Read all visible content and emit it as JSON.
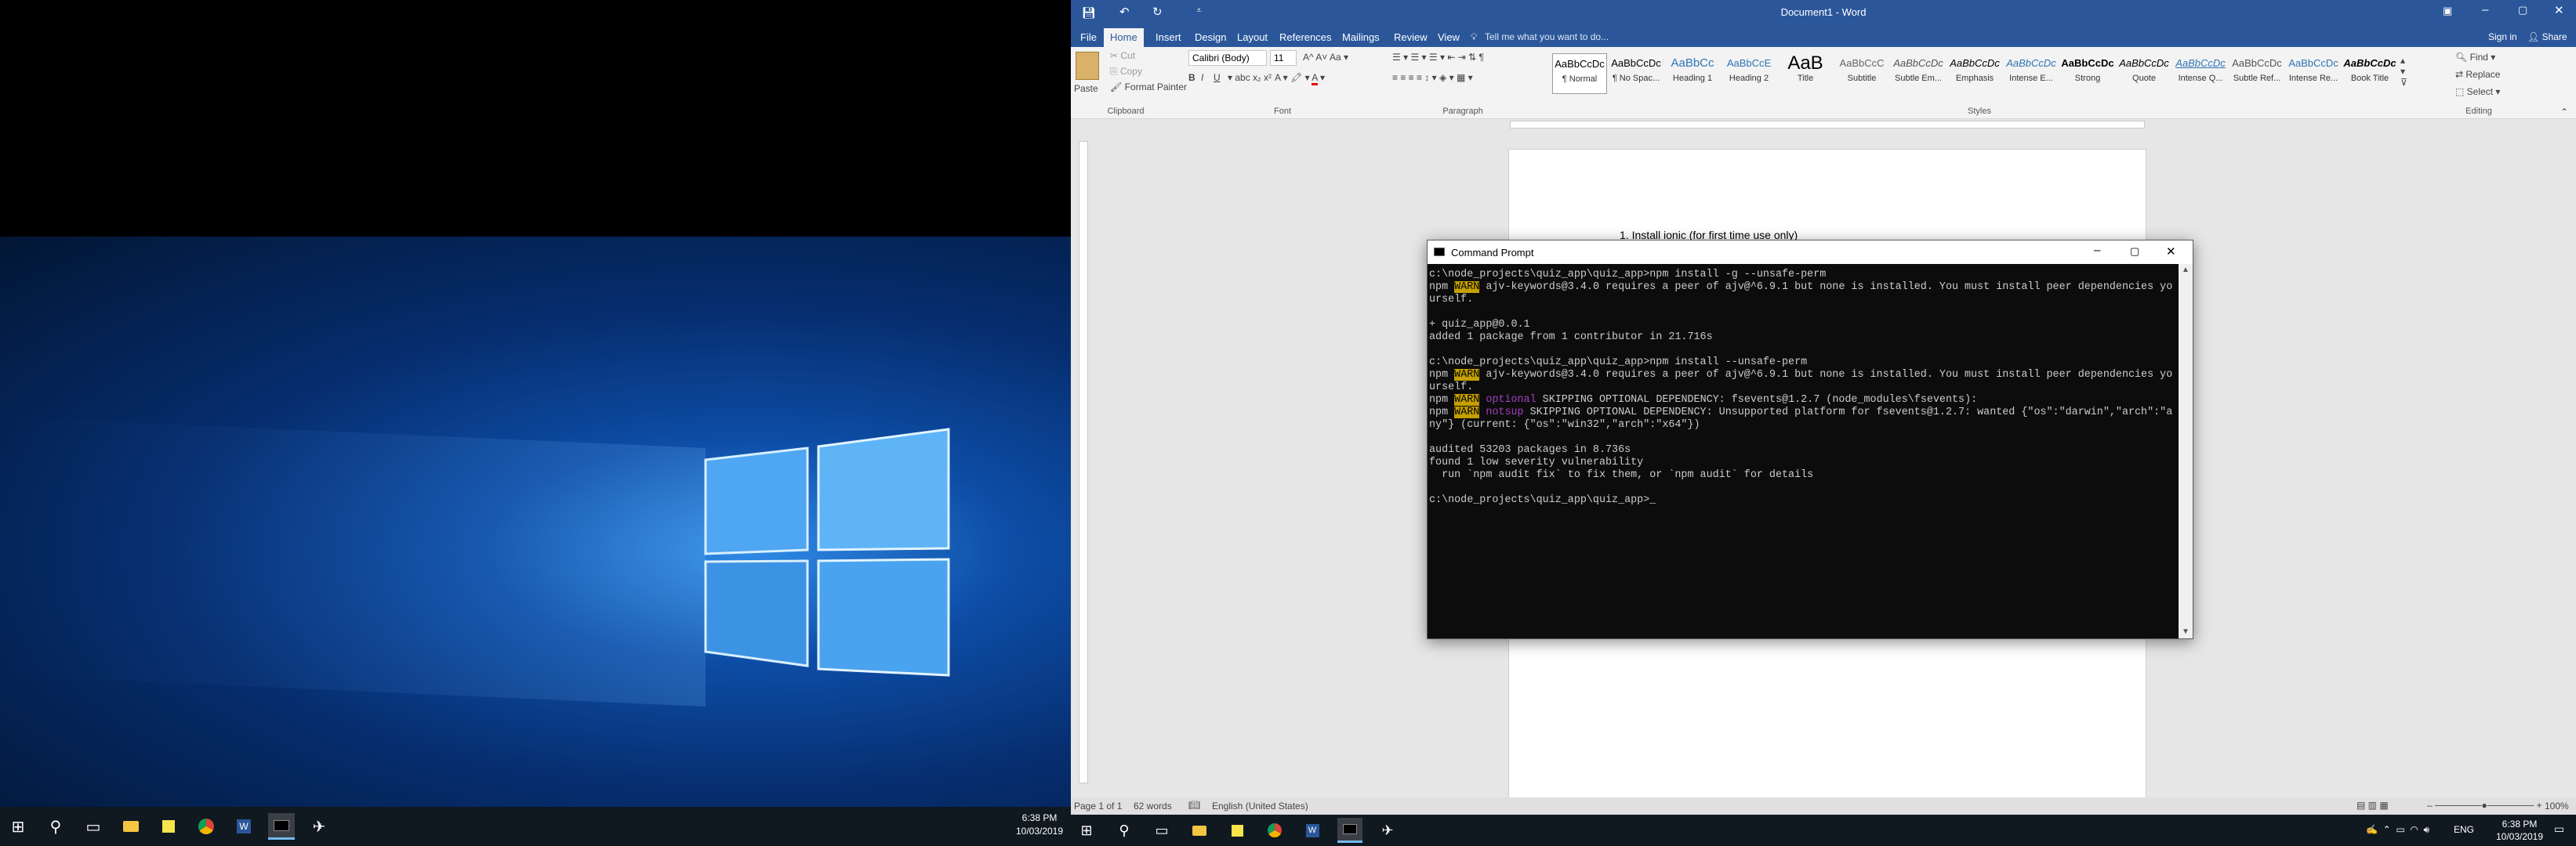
{
  "left_taskbar": {
    "clock_time": "6:38 PM",
    "clock_date": "10/03/2019"
  },
  "word": {
    "window_title": "Document1 - Word",
    "quick_access": [
      "save",
      "undo",
      "redo"
    ],
    "tabs": [
      "File",
      "Home",
      "Insert",
      "Design",
      "Layout",
      "References",
      "Mailings",
      "Review",
      "View"
    ],
    "active_tab": "Home",
    "tell_me": "Tell me what you want to do...",
    "sign_in": "Sign in",
    "share": "Share",
    "clipboard": {
      "paste": "Paste",
      "cut": "Cut",
      "copy": "Copy",
      "format_painter": "Format Painter",
      "group": "Clipboard"
    },
    "font": {
      "name": "Calibri (Body)",
      "size": "11",
      "group": "Font"
    },
    "paragraph_group": "Paragraph",
    "styles_group": "Styles",
    "styles": [
      {
        "sample": "AaBbCcDc",
        "name": "¶ Normal"
      },
      {
        "sample": "AaBbCcDc",
        "name": "¶ No Spac..."
      },
      {
        "sample": "AaBbCc",
        "name": "Heading 1"
      },
      {
        "sample": "AaBbCcE",
        "name": "Heading 2"
      },
      {
        "sample": "AaB",
        "name": "Title"
      },
      {
        "sample": "AaBbCcC",
        "name": "Subtitle"
      },
      {
        "sample": "AaBbCcDc",
        "name": "Subtle Em..."
      },
      {
        "sample": "AaBbCcDc",
        "name": "Emphasis"
      },
      {
        "sample": "AaBbCcDc",
        "name": "Intense E..."
      },
      {
        "sample": "AaBbCcDc",
        "name": "Strong"
      },
      {
        "sample": "AaBbCcDc",
        "name": "Quote"
      },
      {
        "sample": "AaBbCcDc",
        "name": "Intense Q..."
      },
      {
        "sample": "AaBbCcDc",
        "name": "Subtle Ref..."
      },
      {
        "sample": "AaBbCcDc",
        "name": "Intense Re..."
      },
      {
        "sample": "AaBbCcDc",
        "name": "Book Title"
      }
    ],
    "editing": {
      "find": "Find",
      "replace": "Replace",
      "select": "Select",
      "group": "Editing"
    },
    "document_line": "1.   Install ionic (for first time use only)",
    "status": {
      "page": "Page 1 of 1",
      "words": "62 words",
      "language": "English (United States)",
      "zoom": "100%"
    }
  },
  "cmd": {
    "title": "Command Prompt",
    "lines": [
      {
        "text": "c:\\node_projects\\quiz_app\\quiz_app>npm install -g --unsafe-perm"
      },
      {
        "pre": "npm ",
        "tag": "WARN",
        "text": " ajv-keywords@3.4.0 requires a peer of ajv@^6.9.1 but none is installed. You must install peer dependencies yourself."
      },
      {
        "text": ""
      },
      {
        "text": "+ quiz_app@0.0.1"
      },
      {
        "text": "added 1 package from 1 contributor in 21.716s"
      },
      {
        "text": ""
      },
      {
        "text": "c:\\node_projects\\quiz_app\\quiz_app>npm install --unsafe-perm"
      },
      {
        "pre": "npm ",
        "tag": "WARN",
        "text": " ajv-keywords@3.4.0 requires a peer of ajv@^6.9.1 but none is installed. You must install peer dependencies yourself."
      },
      {
        "pre": "npm ",
        "tag": "WARN",
        "opt": " optional",
        "text": " SKIPPING OPTIONAL DEPENDENCY: fsevents@1.2.7 (node_modules\\fsevents):"
      },
      {
        "pre": "npm ",
        "tag": "WARN",
        "opt": " notsup",
        "text": " SKIPPING OPTIONAL DEPENDENCY: Unsupported platform for fsevents@1.2.7: wanted {\"os\":\"darwin\",\"arch\":\"any\"} (current: {\"os\":\"win32\",\"arch\":\"x64\"})"
      },
      {
        "text": ""
      },
      {
        "text": "audited 53203 packages in 8.736s"
      },
      {
        "text": "found 1 low severity vulnerability"
      },
      {
        "text": "  run `npm audit fix` to fix them, or `npm audit` for details"
      },
      {
        "text": ""
      },
      {
        "text": "c:\\node_projects\\quiz_app\\quiz_app>_"
      }
    ]
  },
  "right_taskbar": {
    "language": "ENG",
    "clock_time": "6:38 PM",
    "clock_date": "10/03/2019"
  }
}
